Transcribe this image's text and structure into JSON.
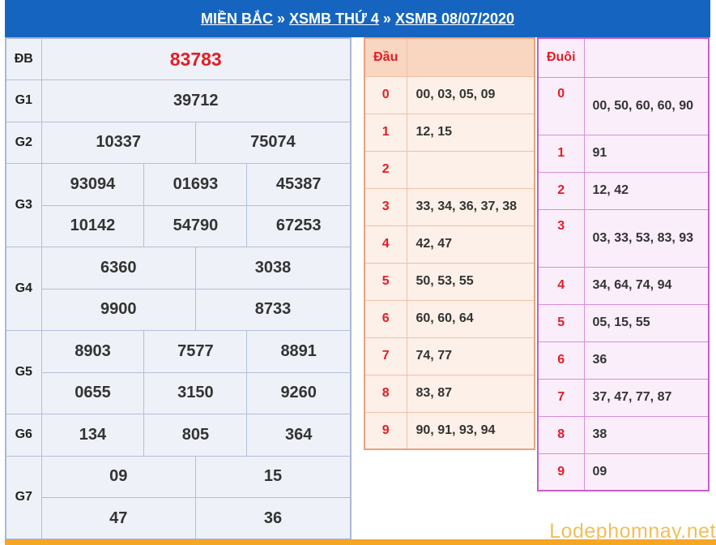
{
  "breadcrumb": [
    "MIỀN BẮC",
    "XSMB THỨ 4",
    "XSMB 08/07/2020"
  ],
  "breadcrumb_separator": "»",
  "results": {
    "db": {
      "label": "ĐB",
      "value": "83783"
    },
    "g1": {
      "label": "G1",
      "values": [
        "39712"
      ]
    },
    "g2": {
      "label": "G2",
      "values": [
        "10337",
        "75074"
      ]
    },
    "g3": {
      "label": "G3",
      "values": [
        "93094",
        "01693",
        "45387",
        "10142",
        "54790",
        "67253"
      ]
    },
    "g4": {
      "label": "G4",
      "values": [
        "6360",
        "3038",
        "9900",
        "8733"
      ]
    },
    "g5": {
      "label": "G5",
      "values": [
        "8903",
        "7577",
        "8891",
        "0655",
        "3150",
        "9260"
      ]
    },
    "g6": {
      "label": "G6",
      "values": [
        "134",
        "805",
        "364"
      ]
    },
    "g7": {
      "label": "G7",
      "values": [
        "09",
        "15",
        "47",
        "36"
      ]
    }
  },
  "dau": {
    "header": "Đầu",
    "rows": [
      {
        "digit": "0",
        "values": "00, 03, 05, 09"
      },
      {
        "digit": "1",
        "values": "12, 15"
      },
      {
        "digit": "2",
        "values": ""
      },
      {
        "digit": "3",
        "values": "33, 34, 36, 37, 38"
      },
      {
        "digit": "4",
        "values": "42, 47"
      },
      {
        "digit": "5",
        "values": "50, 53, 55"
      },
      {
        "digit": "6",
        "values": "60, 60, 64"
      },
      {
        "digit": "7",
        "values": "74, 77"
      },
      {
        "digit": "8",
        "values": "83, 87"
      },
      {
        "digit": "9",
        "values": "90, 91, 93, 94"
      }
    ]
  },
  "duoi": {
    "header": "Đuôi",
    "rows": [
      {
        "digit": "0",
        "values": "00, 50, 60, 60, 90"
      },
      {
        "digit": "1",
        "values": "91"
      },
      {
        "digit": "2",
        "values": "12, 42"
      },
      {
        "digit": "3",
        "values": "03, 33, 53, 83, 93"
      },
      {
        "digit": "4",
        "values": "34, 64, 74, 94"
      },
      {
        "digit": "5",
        "values": "05, 15, 55"
      },
      {
        "digit": "6",
        "values": "36"
      },
      {
        "digit": "7",
        "values": "37, 47, 77, 87"
      },
      {
        "digit": "8",
        "values": "38"
      },
      {
        "digit": "9",
        "values": "09"
      }
    ]
  },
  "watermark": "Lodephomnay.net",
  "colors": {
    "header_bg": "#1565c0",
    "special_prize": "#e51c24",
    "bottom_bar": "#f5a623"
  }
}
